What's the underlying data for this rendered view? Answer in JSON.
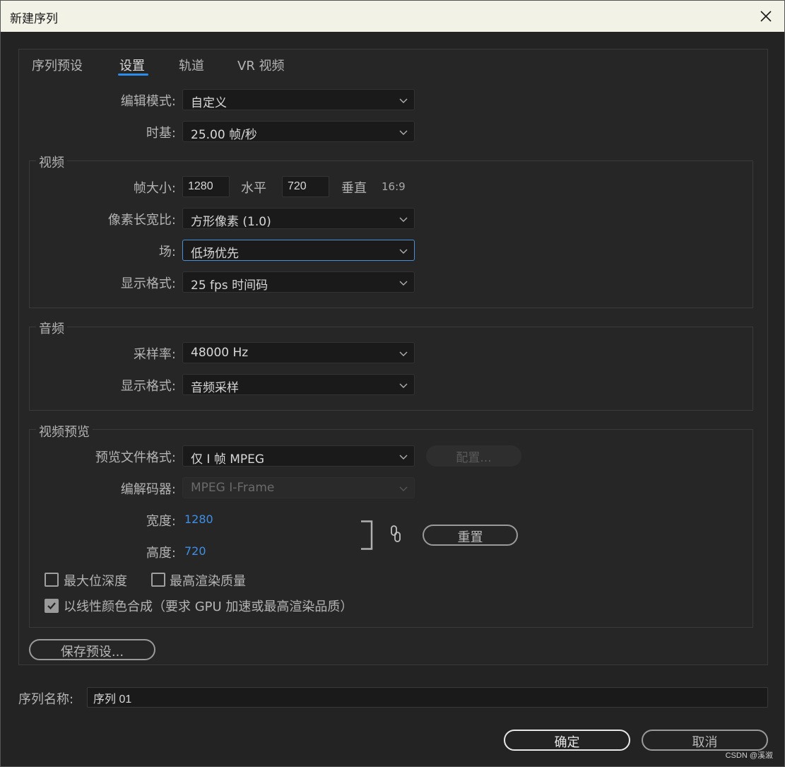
{
  "window": {
    "title": "新建序列"
  },
  "tabs": [
    {
      "label": "序列预设"
    },
    {
      "label": "设置"
    },
    {
      "label": "轨道"
    },
    {
      "label": "VR 视频"
    }
  ],
  "active_tab": "设置",
  "settings": {
    "edit_mode": {
      "label": "编辑模式:",
      "value": "自定义"
    },
    "timebase": {
      "label": "时基:",
      "value": "25.00  帧/秒"
    }
  },
  "video": {
    "title": "视频",
    "frame_size_label": "帧大小:",
    "frame_width": "1280",
    "horizontal_label": "水平",
    "frame_height": "720",
    "vertical_label": "垂直",
    "aspect": "16:9",
    "pixel_aspect": {
      "label": "像素长宽比:",
      "value": "方形像素 (1.0)"
    },
    "fields": {
      "label": "场:",
      "value": "低场优先"
    },
    "display_format": {
      "label": "显示格式:",
      "value": "25 fps 时间码"
    }
  },
  "audio": {
    "title": "音频",
    "sample_rate": {
      "label": "采样率:",
      "value": "48000 Hz"
    },
    "display_format": {
      "label": "显示格式:",
      "value": "音频采样"
    }
  },
  "preview": {
    "title": "视频预览",
    "file_format": {
      "label": "预览文件格式:",
      "value": "仅 I 帧 MPEG"
    },
    "configure_label": "配置...",
    "codec": {
      "label": "编解码器:",
      "value": "MPEG I-Frame"
    },
    "width_label": "宽度:",
    "width_value": "1280",
    "height_label": "高度:",
    "height_value": "720",
    "reset_label": "重置",
    "max_bit_depth": {
      "label": "最大位深度",
      "checked": false
    },
    "max_render_quality": {
      "label": "最高渲染质量",
      "checked": false
    },
    "linear_color": {
      "label": "以线性颜色合成（要求 GPU 加速或最高渲染品质）",
      "checked": true
    }
  },
  "save_preset_label": "保存预设...",
  "sequence_name": {
    "label": "序列名称:",
    "value": "序列 01"
  },
  "ok_label": "确定",
  "cancel_label": "取消",
  "watermark": "CSDN @溪溆",
  "colors": {
    "accent": "#2d8ceb",
    "background": "#232323",
    "titlebar": "#f2f2e6"
  }
}
